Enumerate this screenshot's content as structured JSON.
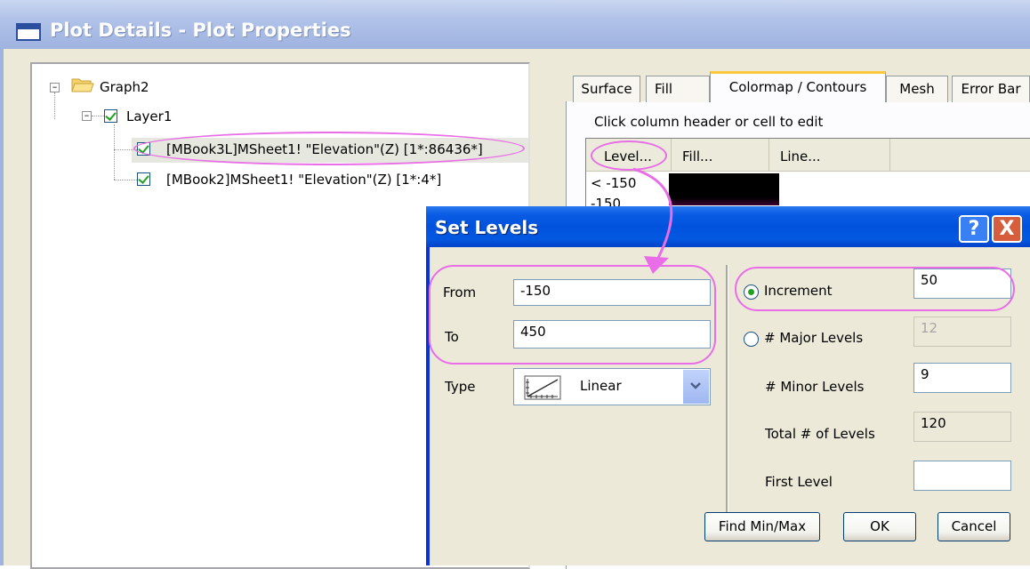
{
  "window": {
    "title": "Plot Details - Plot Properties"
  },
  "tree": {
    "root": "Graph2",
    "layer": "Layer1",
    "plots": [
      "[MBook3L]MSheet1! \"Elevation\"(Z) [1*:86436*]",
      "[MBook2]MSheet1! \"Elevation\"(Z) [1*:4*]"
    ]
  },
  "tabs": [
    "Surface",
    "Fill",
    "Colormap / Contours",
    "Mesh",
    "Error Bar"
  ],
  "colormap": {
    "hint": "Click column header or cell to edit",
    "columns": [
      "Level...",
      "Fill...",
      "Line..."
    ],
    "rows": [
      "< -150",
      "-150"
    ]
  },
  "dialog": {
    "title": "Set Levels",
    "help": "?",
    "close": "X",
    "from_label": "From",
    "from_value": "-150",
    "to_label": "To",
    "to_value": "450",
    "type_label": "Type",
    "type_value": "Linear",
    "increment_label": "Increment",
    "increment_value": "50",
    "major_label": "# Major Levels",
    "major_value": "12",
    "minor_label": "# Minor Levels",
    "minor_value": "9",
    "total_label": "Total # of Levels",
    "total_value": "120",
    "first_label": "First Level",
    "first_value": "",
    "btn_findminmax": "Find Min/Max",
    "btn_ok": "OK",
    "btn_cancel": "Cancel"
  },
  "colors": {
    "annotation": "#e86de6",
    "titlebar_active": "#0152dd",
    "check": "#21a121"
  }
}
